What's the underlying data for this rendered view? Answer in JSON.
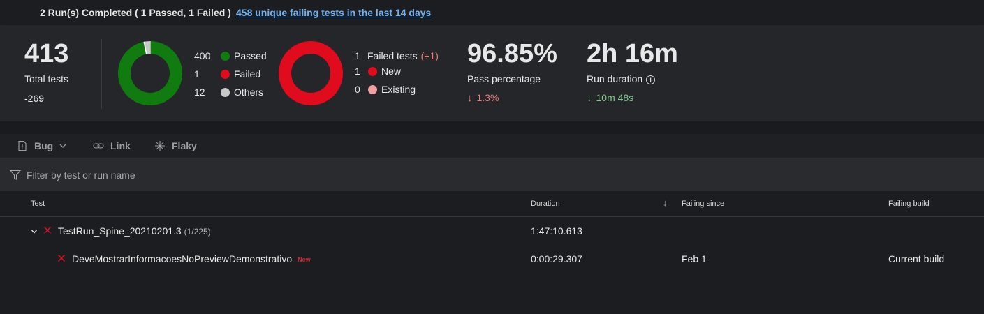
{
  "header": {
    "summary": "2 Run(s) Completed ( 1 Passed, 1 Failed )",
    "failing_link": "458 unique failing tests in the last 14 days"
  },
  "total": {
    "value": "413",
    "label": "Total tests",
    "delta": "-269"
  },
  "outcome_chart": {
    "type": "pie",
    "items": [
      {
        "count": "400",
        "label": "Passed",
        "value": 400,
        "color": "#107c10"
      },
      {
        "count": "1",
        "label": "Failed",
        "value": 1,
        "color": "#e00b1c"
      },
      {
        "count": "12",
        "label": "Others",
        "value": 12,
        "color": "#c8c8c8"
      }
    ]
  },
  "failed_chart": {
    "type": "pie",
    "header_count": "1",
    "header_label": "Failed tests",
    "header_delta": "(+1)",
    "items": [
      {
        "count": "1",
        "label": "New",
        "value": 1,
        "color": "#e00b1c"
      },
      {
        "count": "0",
        "label": "Existing",
        "value": 0,
        "color": "#f1a0a0"
      }
    ]
  },
  "pass_pct": {
    "value": "96.85%",
    "label": "Pass percentage",
    "delta": "1.3%"
  },
  "duration": {
    "value": "2h 16m",
    "label": "Run duration",
    "delta": "10m 48s"
  },
  "toolbar": {
    "bug": "Bug",
    "link": "Link",
    "flaky": "Flaky"
  },
  "filter": {
    "placeholder": "Filter by test or run name",
    "value": ""
  },
  "table": {
    "columns": {
      "test": "Test",
      "duration": "Duration",
      "failing_since": "Failing since",
      "failing_build": "Failing build"
    },
    "group": {
      "name": "TestRun_Spine_20210201.3",
      "count": "(1/225)",
      "duration": "1:47:10.613"
    },
    "rows": [
      {
        "name": "DeveMostrarInformacoesNoPreviewDemonstrativo",
        "tag": "New",
        "duration": "0:00:29.307",
        "failing_since": "Feb 1",
        "failing_build": "Current build"
      }
    ]
  },
  "colors": {
    "passed": "#107c10",
    "failed": "#e00b1c",
    "others": "#c8c8c8",
    "existing": "#f1a0a0",
    "link": "#6fb1f2",
    "bad_delta": "#f07a7a",
    "good_delta": "#7ec78a"
  }
}
